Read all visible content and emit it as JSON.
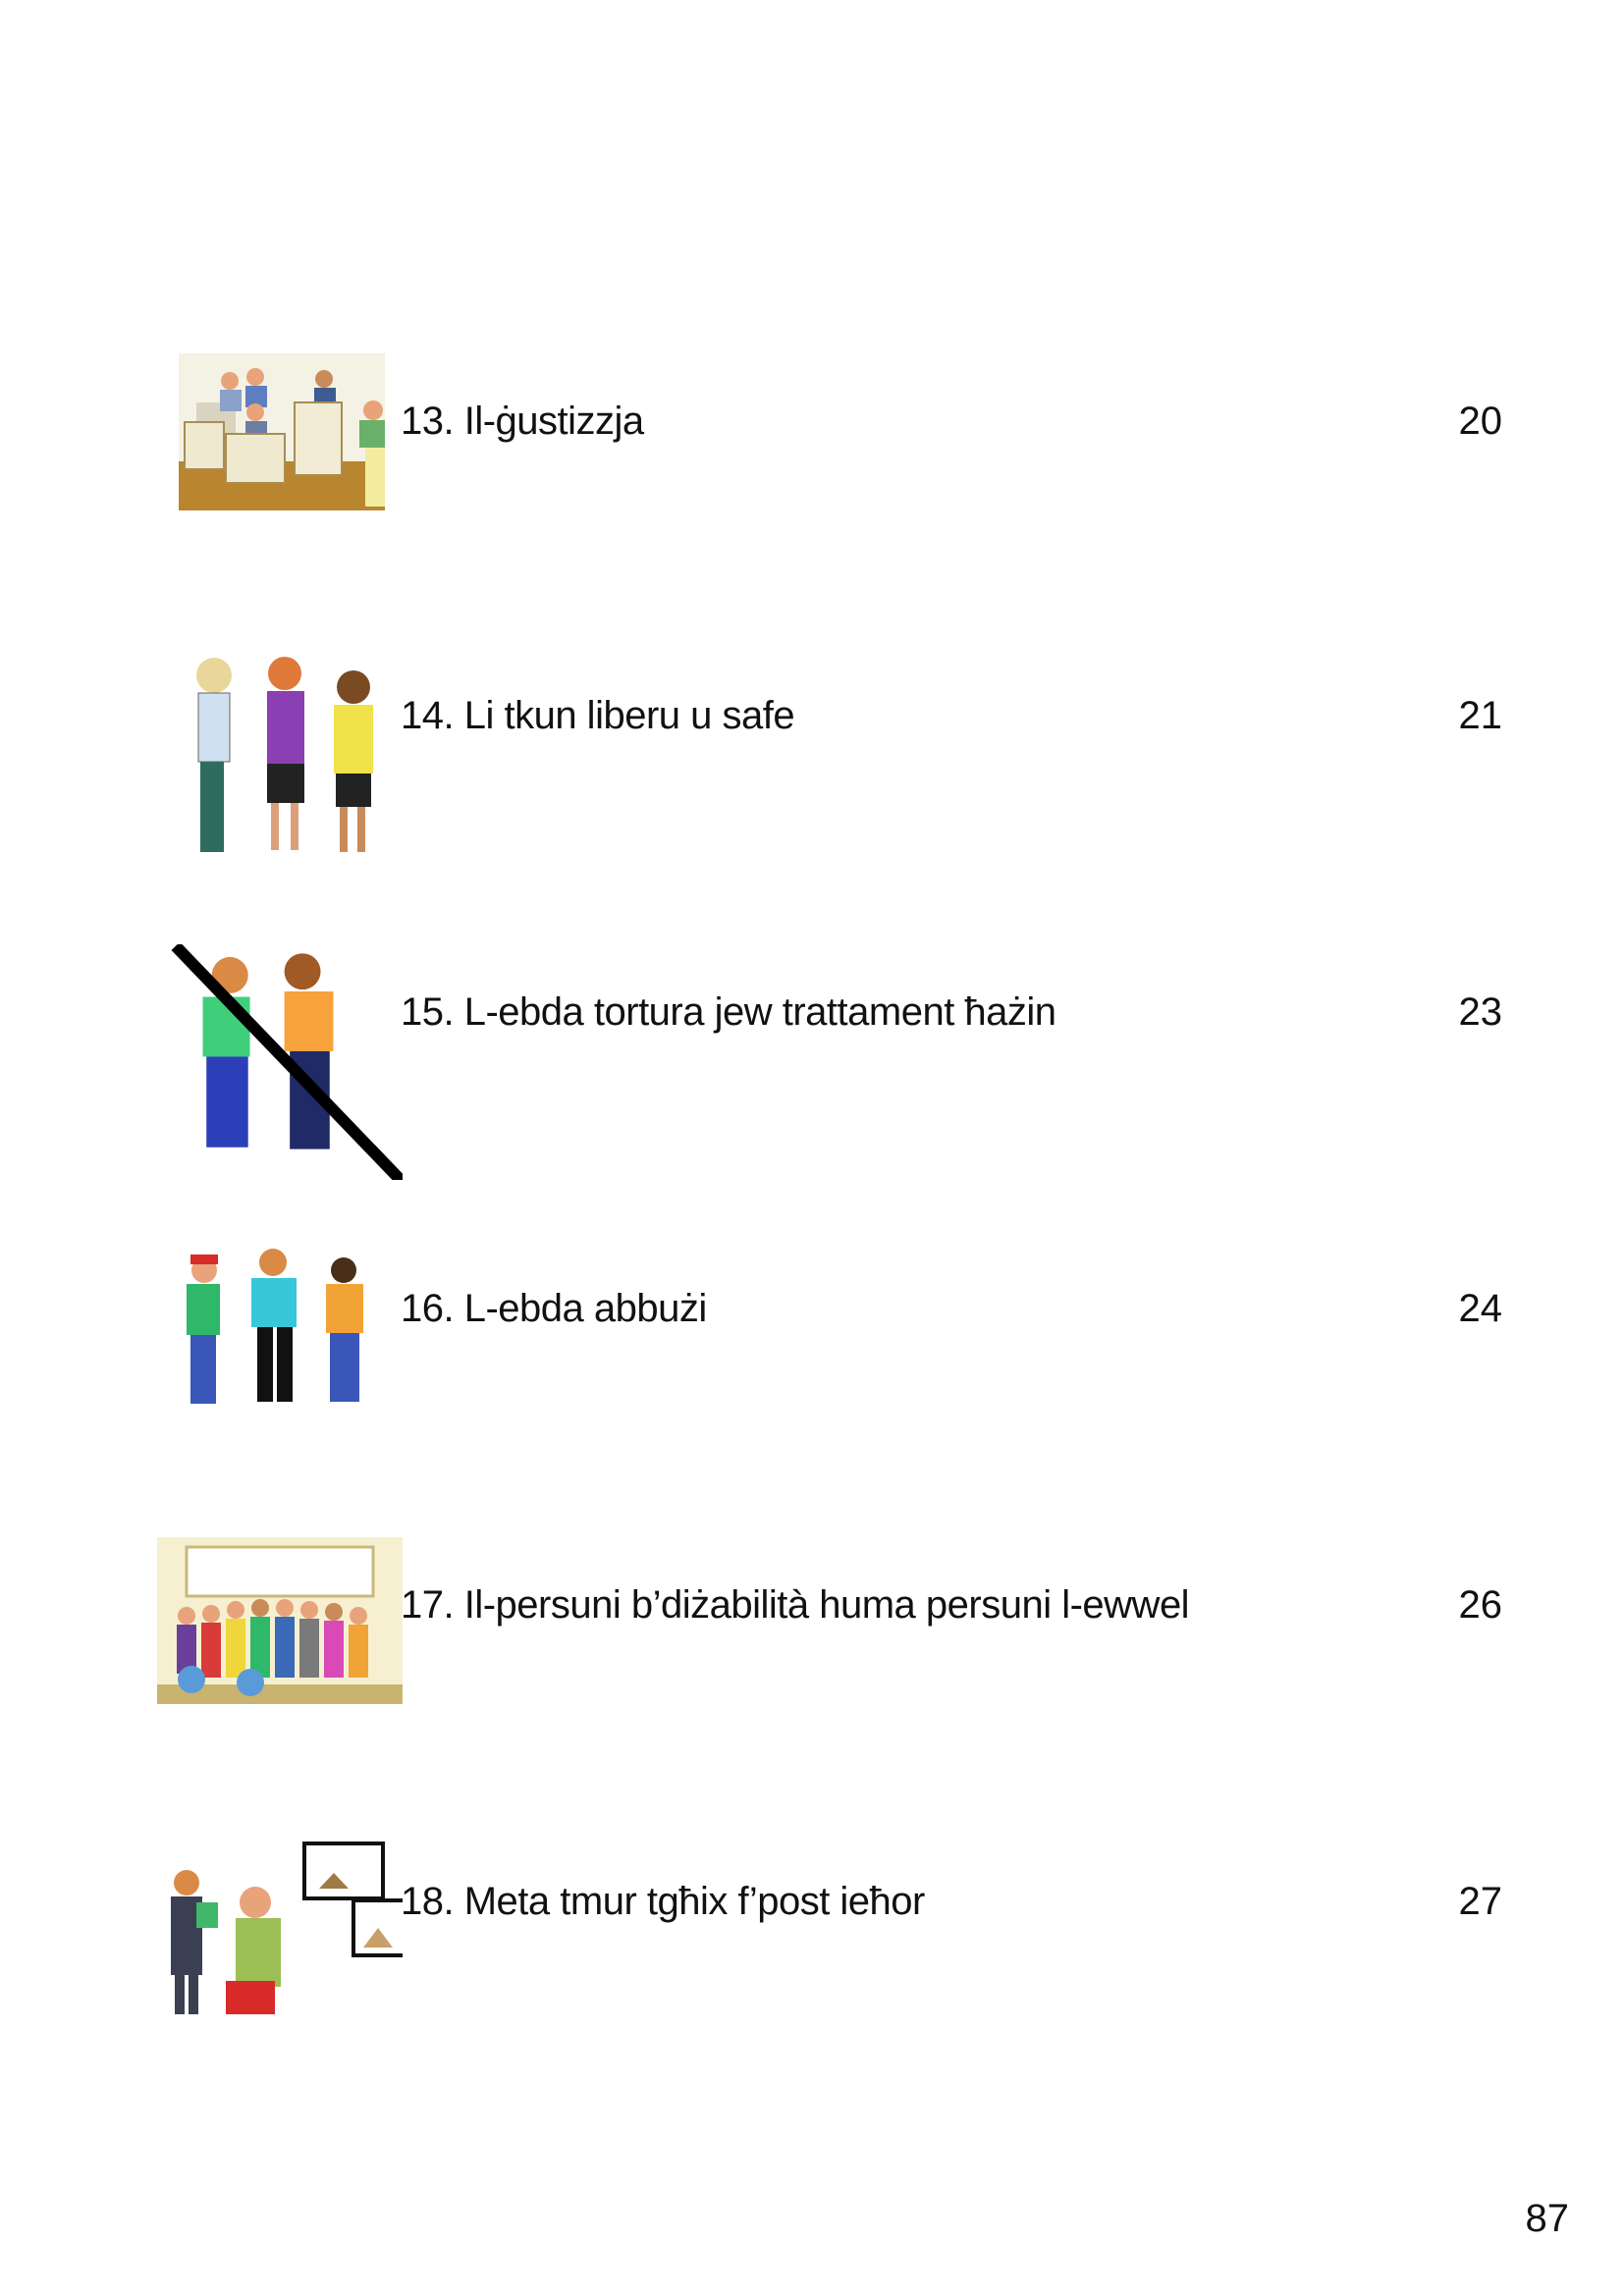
{
  "entries": [
    {
      "label": "13. Il-ġustizzja",
      "page": "20",
      "icon": "courtroom-icon"
    },
    {
      "label": "14. Li tkun liberu u safe",
      "page": "21",
      "icon": "people-group-icon"
    },
    {
      "label": "15. L-ebda tortura jew trattament ħażin",
      "page": "23",
      "icon": "no-fighting-icon"
    },
    {
      "label": "16. L-ebda abbużi",
      "page": "24",
      "icon": "bullying-icon"
    },
    {
      "label": "17. Il-persuni b’diżabilità huma persuni l-ewwel",
      "page": "26",
      "icon": "group-photo-icon"
    },
    {
      "label": "18. Meta tmur tgħix f’post ieħor",
      "page": "27",
      "icon": "moving-house-icon"
    }
  ],
  "footer": {
    "page_number": "87"
  }
}
